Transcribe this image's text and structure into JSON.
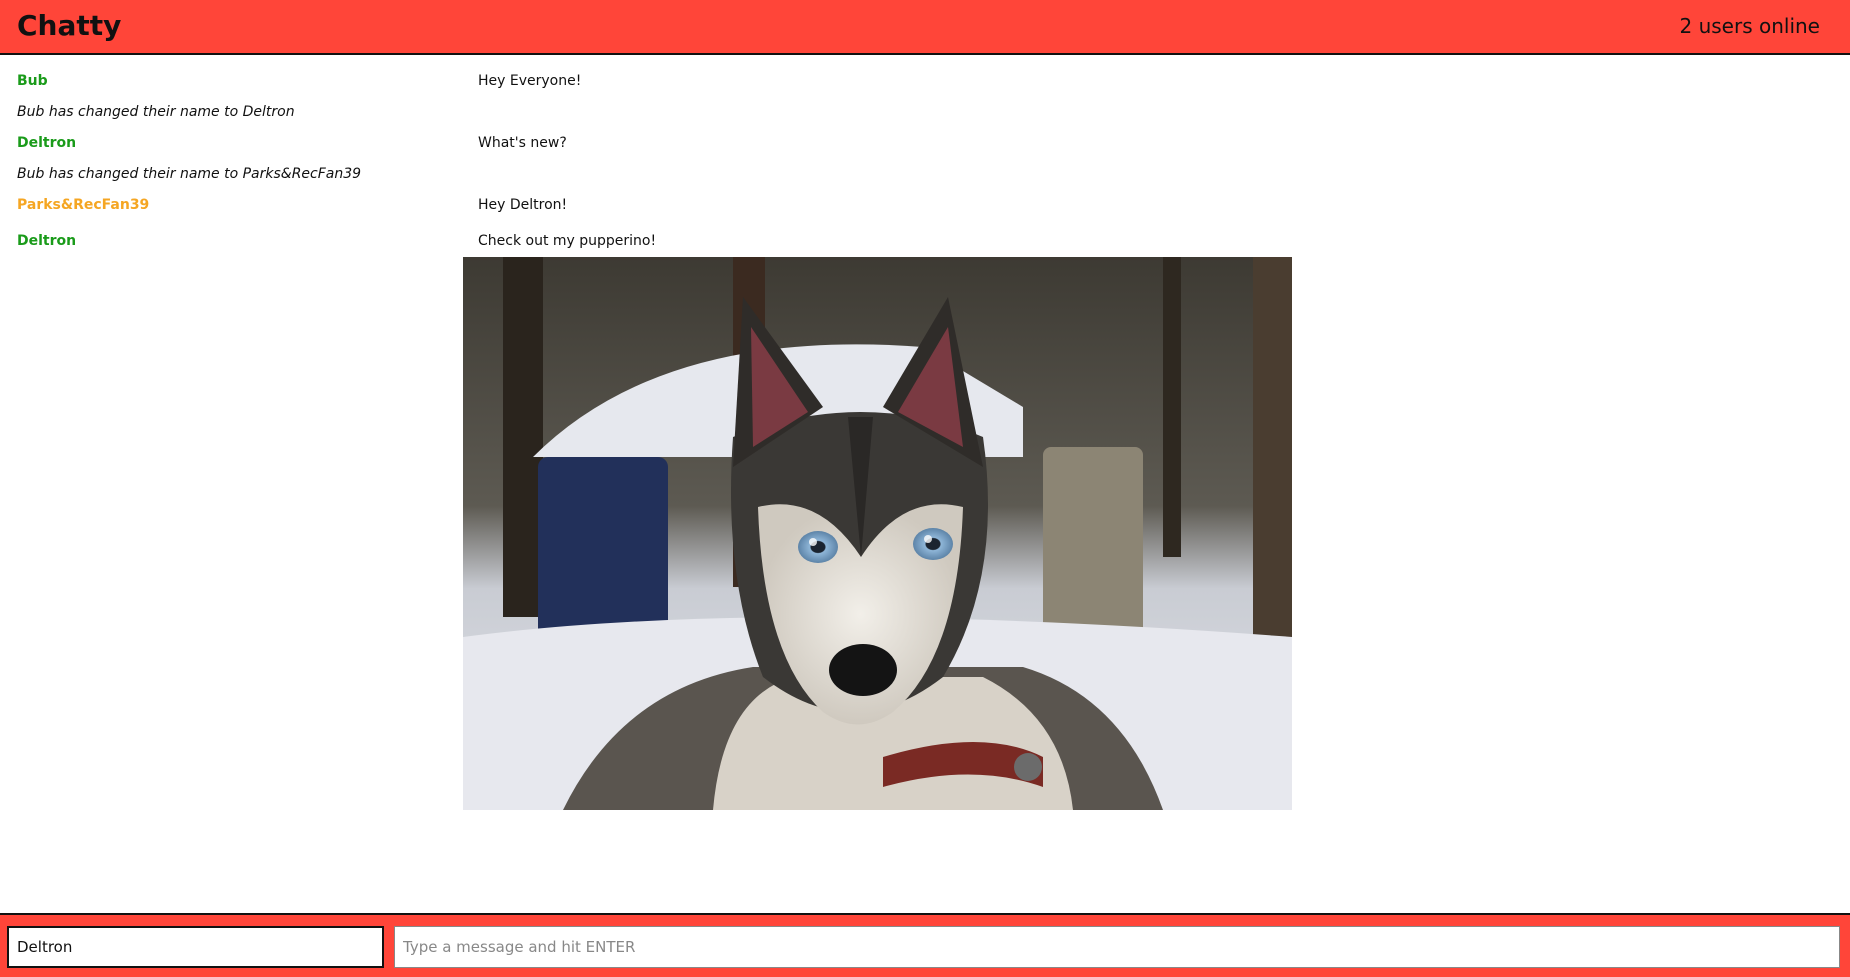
{
  "header": {
    "title": "Chatty",
    "online": "2 users online"
  },
  "colors": {
    "accent": "#ff4539",
    "user_green": "#1a9b1a",
    "user_orange": "#f5a623"
  },
  "messages": [
    {
      "type": "message",
      "username": "Bub",
      "color": "#1a9b1a",
      "content": "Hey Everyone!"
    },
    {
      "type": "notification",
      "content": "Bub has changed their name to Deltron"
    },
    {
      "type": "message",
      "username": "Deltron",
      "color": "#1a9b1a",
      "content": "What's new?"
    },
    {
      "type": "notification",
      "content": "Bub has changed their name to Parks&RecFan39"
    },
    {
      "type": "message",
      "username": "Parks&RecFan39",
      "color": "#f5a623",
      "content": "Hey Deltron!"
    },
    {
      "type": "message",
      "username": "Deltron",
      "color": "#1a9b1a",
      "content": "Check out my pupperino!",
      "image": "husky-dog-photo"
    }
  ],
  "chatbar": {
    "name_value": "Deltron",
    "message_placeholder": "Type a message and hit ENTER"
  }
}
